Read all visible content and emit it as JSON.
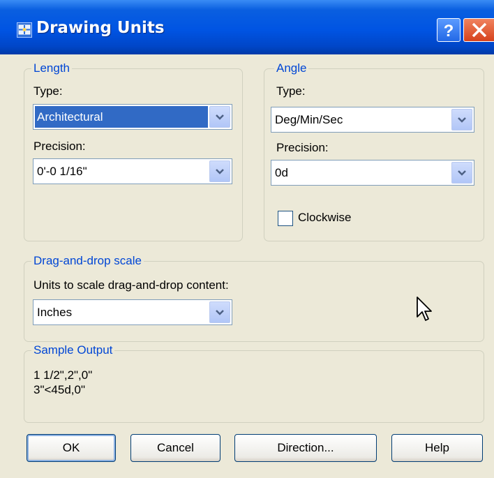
{
  "window": {
    "title": "Drawing Units",
    "help_button": "?",
    "close_button": "×",
    "app_icon": "drawing-units-icon"
  },
  "length": {
    "legend": "Length",
    "type_label": "Type:",
    "type_value": "Architectural",
    "precision_label": "Precision:",
    "precision_value": "0'-0 1/16\""
  },
  "angle": {
    "legend": "Angle",
    "type_label": "Type:",
    "type_value": "Deg/Min/Sec",
    "precision_label": "Precision:",
    "precision_value": "0d",
    "clockwise_label": "Clockwise",
    "clockwise_checked": false
  },
  "drag_drop": {
    "legend": "Drag-and-drop scale",
    "units_label": "Units to scale drag-and-drop content:",
    "units_value": "Inches"
  },
  "sample": {
    "legend": "Sample Output",
    "line1": "1 1/2\",2\",0\"",
    "line2": "3\"<45d,0\""
  },
  "buttons": {
    "ok": "OK",
    "cancel": "Cancel",
    "direction": "Direction...",
    "help": "Help"
  },
  "colors": {
    "titlebar": "#0054e3",
    "legend_text": "#0046d5",
    "selection": "#316ac5",
    "dialog_bg": "#ece9d8"
  }
}
